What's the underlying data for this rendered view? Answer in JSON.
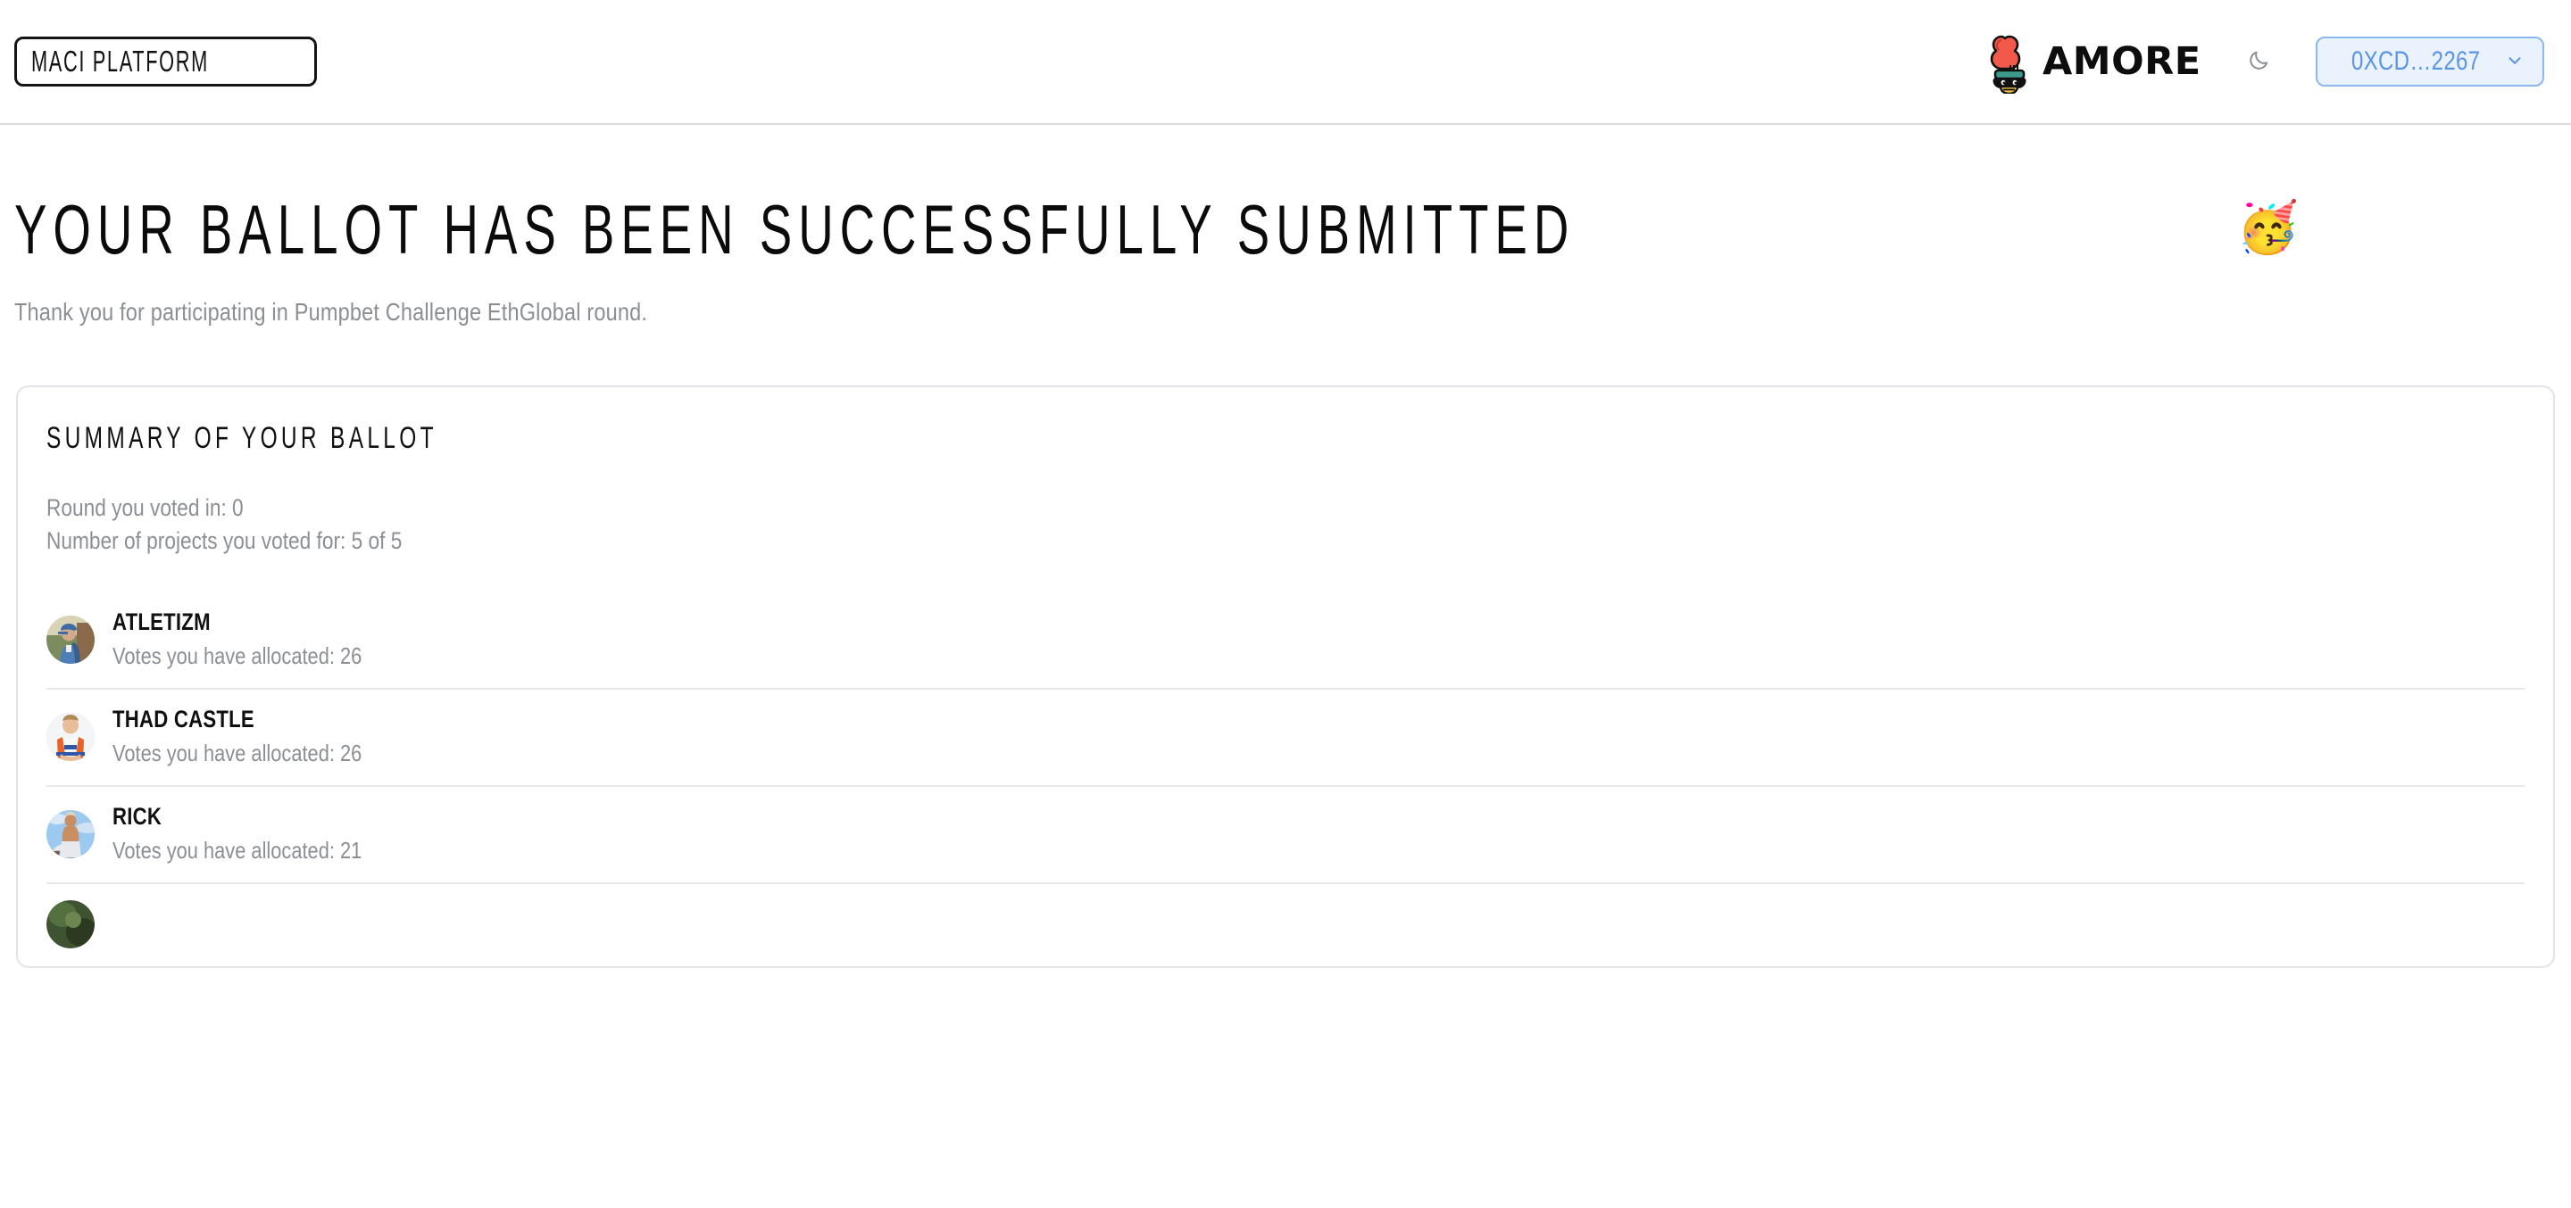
{
  "header": {
    "brand_label": "MACI PLATFORM",
    "round_logo": {
      "wordmark": "AMORE",
      "mascot_icon": "rooster-mascot-icon",
      "crest_color": "#f2594b",
      "collar_color": "#3e9a8c",
      "body_color": "#101010",
      "beak_color": "#f5c242"
    },
    "theme_toggle": {
      "icon": "moon-icon",
      "label": "Toggle dark mode"
    },
    "wallet": {
      "address": "0XCD…2267",
      "chevron_icon": "chevron-down-icon",
      "text_color": "#5b93e8",
      "border_color": "#8cb7ef",
      "background_color": "#eaf2fd"
    }
  },
  "page": {
    "title": "YOUR BALLOT HAS BEEN SUCCESSFULLY SUBMITTED",
    "title_emoji": "🥳",
    "subtitle": "Thank you for participating in Pumpbet Challenge EthGlobal round."
  },
  "summary_card": {
    "title": "SUMMARY OF YOUR BALLOT",
    "meta": [
      "Round you voted in: 0",
      "Number of projects you voted for: 5 of 5"
    ],
    "projects": [
      {
        "name": "ATLETIZM",
        "votes_label": "Votes you have allocated: 26",
        "avatar_icon": "avatar-photo-hiker",
        "avatar_colors": [
          "#8ba6c6",
          "#3f6ba4",
          "#6b8a5e",
          "#d8c9ae"
        ]
      },
      {
        "name": "THAD CASTLE",
        "votes_label": "Votes you have allocated: 26",
        "avatar_icon": "avatar-photo-football-player",
        "avatar_colors": [
          "#f2f2f2",
          "#e8622a",
          "#2f56a8",
          "#e7bd9a"
        ]
      },
      {
        "name": "RICK",
        "votes_label": "Votes you have allocated: 21",
        "avatar_icon": "avatar-photo-skater",
        "avatar_colors": [
          "#9cc9ef",
          "#d7e7f7",
          "#c98f63",
          "#b9c3cc"
        ]
      },
      {
        "name": "",
        "votes_label": "",
        "avatar_icon": "avatar-photo-olive",
        "avatar_colors": [
          "#3f5231",
          "#55703f",
          "#2c3a22",
          "#6d8551"
        ]
      }
    ]
  }
}
